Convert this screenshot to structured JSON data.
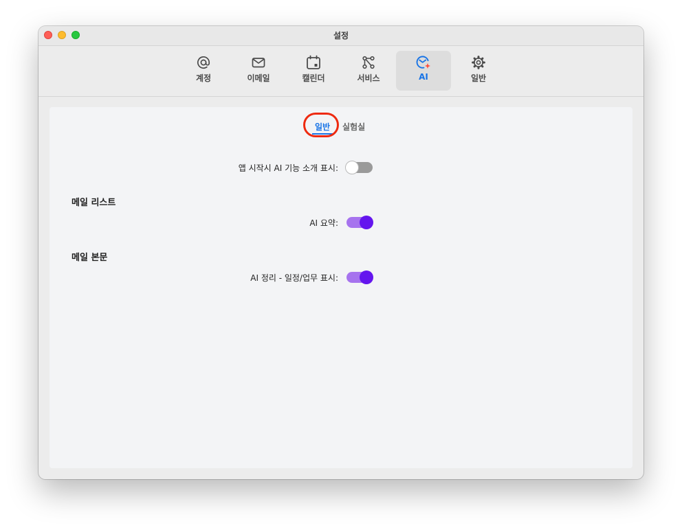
{
  "window": {
    "title": "설정"
  },
  "toolbar": {
    "items": [
      {
        "label": "계정",
        "icon": "at-sign-icon",
        "active": false
      },
      {
        "label": "이메일",
        "icon": "envelope-icon",
        "active": false
      },
      {
        "label": "캘린더",
        "icon": "calendar-icon",
        "active": false
      },
      {
        "label": "서비스",
        "icon": "services-icon",
        "active": false
      },
      {
        "label": "AI",
        "icon": "ai-mail-icon",
        "active": true
      },
      {
        "label": "일반",
        "icon": "gear-icon",
        "active": false
      }
    ]
  },
  "subtabs": {
    "general": "일반",
    "lab": "실험실",
    "selected": "일반"
  },
  "settings": {
    "intro": {
      "label": "앱 시작시 AI 기능 소개 표시:",
      "enabled": false
    },
    "mail_list": {
      "title": "메일 리스트",
      "summary": {
        "label": "AI 요약:",
        "enabled": true
      }
    },
    "mail_body": {
      "title": "메일 본문",
      "organize": {
        "label": "AI 정리 - 일정/업무 표시:",
        "enabled": true
      }
    }
  },
  "colors": {
    "accent": "#1773e6",
    "toggle_on_track": "#a673ee",
    "toggle_on_knob": "#6415ee",
    "highlight": "#ee2a10"
  }
}
